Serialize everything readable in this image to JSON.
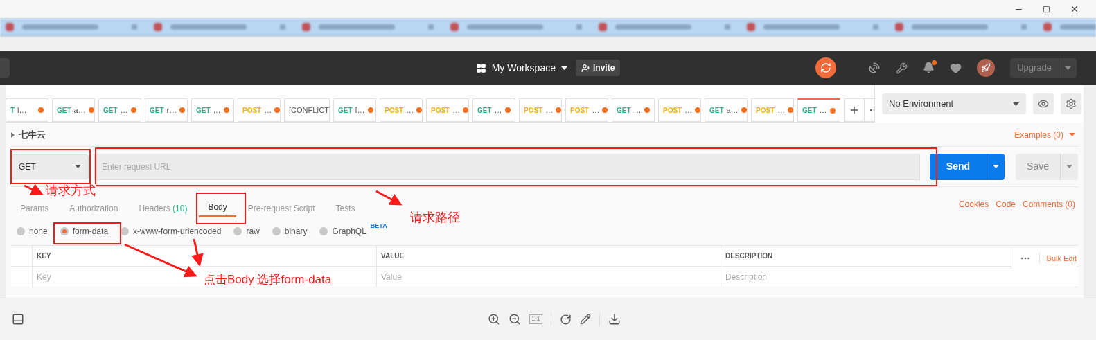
{
  "header": {
    "workspace": "My Workspace",
    "invite": "Invite",
    "upgrade": "Upgrade",
    "has_notification": true
  },
  "request_tabs": [
    {
      "kind": "get",
      "method": "T",
      "name": "l…",
      "unsaved": true,
      "selected": false
    },
    {
      "kind": "get",
      "method": "GET",
      "name": "a…",
      "unsaved": true,
      "selected": false
    },
    {
      "kind": "get",
      "method": "GET",
      "name": "…",
      "unsaved": true,
      "selected": false
    },
    {
      "kind": "get",
      "method": "GET",
      "name": "r…",
      "unsaved": true,
      "selected": false
    },
    {
      "kind": "get",
      "method": "GET",
      "name": "…",
      "unsaved": true,
      "selected": false
    },
    {
      "kind": "post",
      "method": "POST",
      "name": "…",
      "unsaved": true,
      "selected": false
    },
    {
      "kind": "plain",
      "name": "[CONFLICT",
      "unsaved": false,
      "selected": false
    },
    {
      "kind": "get",
      "method": "GET",
      "name": "f…",
      "unsaved": true,
      "selected": false
    },
    {
      "kind": "post",
      "method": "POST",
      "name": "…",
      "unsaved": true,
      "selected": false
    },
    {
      "kind": "post",
      "method": "POST",
      "name": "…",
      "unsaved": true,
      "selected": false
    },
    {
      "kind": "get",
      "method": "GET",
      "name": "…",
      "unsaved": true,
      "selected": false
    },
    {
      "kind": "post",
      "method": "POST",
      "name": "…",
      "unsaved": true,
      "selected": false
    },
    {
      "kind": "post",
      "method": "POST",
      "name": "…",
      "unsaved": true,
      "selected": false
    },
    {
      "kind": "get",
      "method": "GET",
      "name": "…",
      "unsaved": true,
      "selected": false
    },
    {
      "kind": "post",
      "method": "POST",
      "name": "…",
      "unsaved": true,
      "selected": false
    },
    {
      "kind": "get",
      "method": "GET",
      "name": "a…",
      "unsaved": true,
      "selected": false
    },
    {
      "kind": "post",
      "method": "POST",
      "name": "…",
      "unsaved": true,
      "selected": false
    },
    {
      "kind": "get",
      "method": "GET",
      "name": "…",
      "unsaved": true,
      "selected": true
    }
  ],
  "environment": "No Environment",
  "collection": "七牛云",
  "examples": "Examples (0)",
  "request": {
    "method": "GET",
    "url_placeholder": "Enter request URL",
    "send": "Send",
    "save": "Save"
  },
  "section_tabs": [
    {
      "label": "Params",
      "selected": false
    },
    {
      "label": "Authorization",
      "selected": false
    },
    {
      "label": "Headers",
      "count": "(10)",
      "selected": false
    },
    {
      "label": "Body",
      "selected": true
    },
    {
      "label": "Pre-request Script",
      "selected": false
    },
    {
      "label": "Tests",
      "selected": false
    }
  ],
  "section_links": [
    "Cookies",
    "Code",
    "Comments (0)"
  ],
  "body_types": [
    {
      "label": "none",
      "selected": false
    },
    {
      "label": "form-data",
      "selected": true
    },
    {
      "label": "x-www-form-urlencoded",
      "selected": false
    },
    {
      "label": "raw",
      "selected": false
    },
    {
      "label": "binary",
      "selected": false
    },
    {
      "label": "GraphQL",
      "badge": "BETA",
      "selected": false
    }
  ],
  "params_table": {
    "columns": [
      "KEY",
      "VALUE",
      "DESCRIPTION"
    ],
    "bulk_edit": "Bulk Edit",
    "placeholders": [
      "Key",
      "Value",
      "Description"
    ]
  },
  "viewer_toolbar": {
    "actual_size": "1:1"
  },
  "annotations": [
    "请求方式",
    "请求路径",
    "点击Body 选择form-data"
  ]
}
